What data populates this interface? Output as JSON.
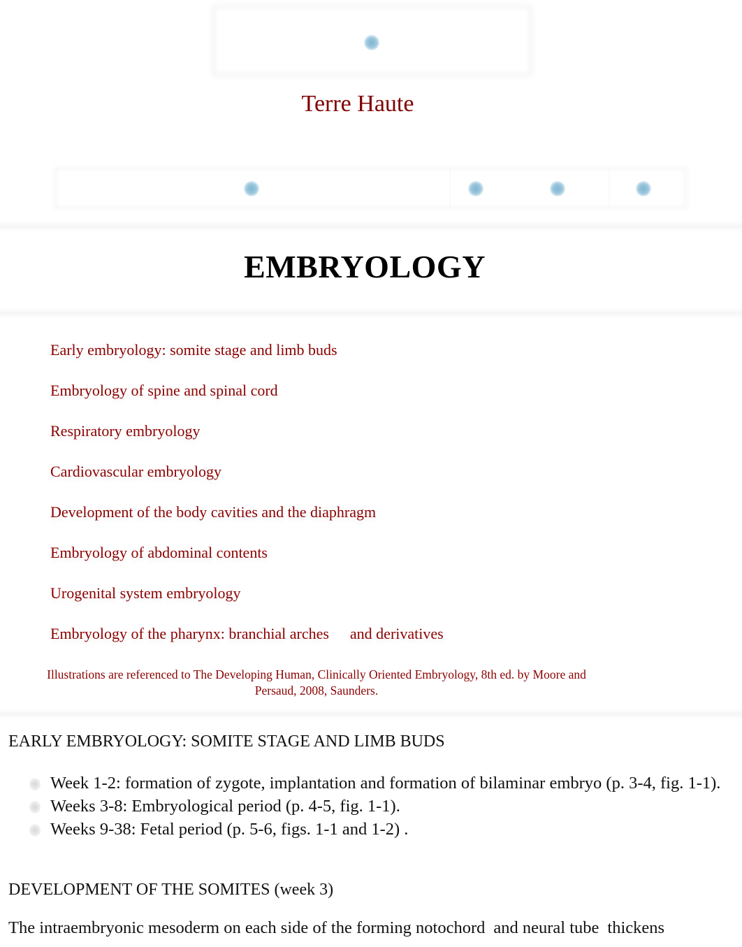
{
  "header": {
    "logo_placeholder": "image-placeholder",
    "site_title": "Terre Haute",
    "nav_placeholders": [
      "image-placeholder",
      "image-placeholder",
      "image-placeholder",
      "image-placeholder"
    ]
  },
  "page": {
    "heading": "EMBRYOLOGY",
    "link_color": "#8b0000"
  },
  "toc": {
    "items": [
      {
        "label": "Early embryology: somite stage and limb buds"
      },
      {
        "label": "Embryology of spine and spinal cord"
      },
      {
        "label": "Respiratory embryology"
      },
      {
        "label": "Cardiovascular embryology"
      },
      {
        "label": "Development of the body cavities and the diaphragm"
      },
      {
        "label": "Embryology of abdominal contents"
      },
      {
        "label": "Urogenital system embryology"
      },
      {
        "label_part1": "Embryology of the pharynx: branchial arches",
        "label_part2": "and derivatives"
      }
    ]
  },
  "citation": {
    "line1": "Illustrations are referenced to The Developing Human, Clinically Oriented Embryology, 8th ed. by Moore and",
    "line2": "Persaud, 2008, Saunders."
  },
  "section1": {
    "heading": "EARLY EMBRYOLOGY: SOMITE STAGE AND LIMB BUDS",
    "bullets": [
      "Week 1-2: formation of zygote, implantation and formation of bilaminar embryo (p. 3-4, fig. 1-1).",
      "Weeks 3-8: Embryological period (p. 4-5, fig. 1-1).",
      "Weeks 9-38: Fetal period (p. 5-6, figs. 1-1 and 1-2) ."
    ]
  },
  "section2": {
    "heading": "DEVELOPMENT OF THE SOMITES (week 3)",
    "text_part1": "The intraembryonic mesoderm on each side of the forming notochord",
    "text_part2": "and neural tube",
    "text_part3": "thickens"
  }
}
